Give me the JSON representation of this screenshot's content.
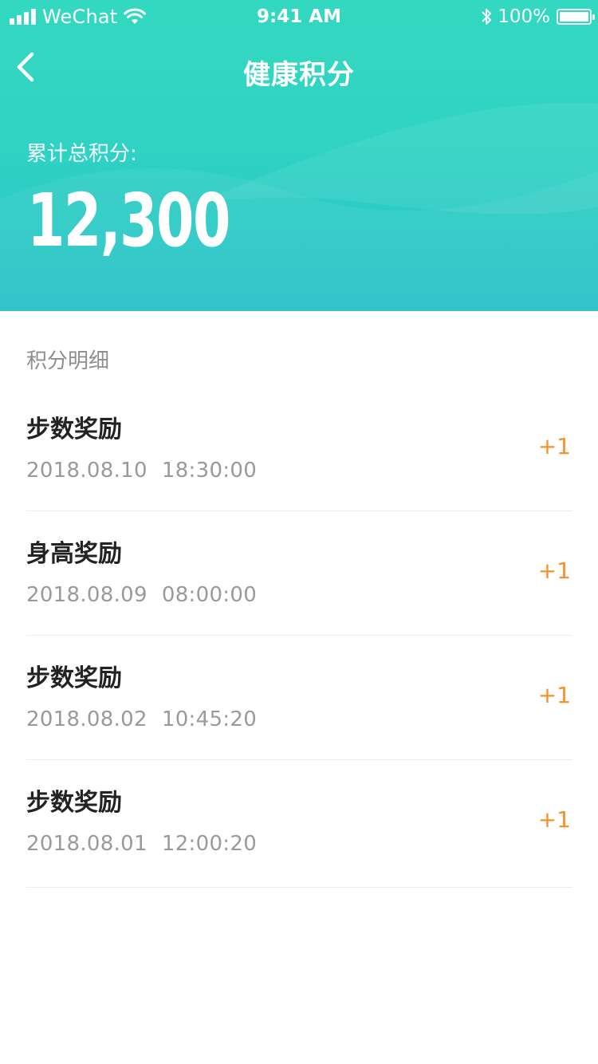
{
  "status_bar": {
    "carrier": "WeChat",
    "time": "9:41 AM",
    "battery": "100%"
  },
  "header": {
    "title": "健康积分",
    "total_label": "累计总积分:",
    "total_value": "12,300"
  },
  "colors": {
    "header_gradient_top": "#33d8c0",
    "header_gradient_bottom": "#27c1c8",
    "points": "#f5912b"
  },
  "details": {
    "section_title": "积分明细",
    "items": [
      {
        "title": "步数奖励",
        "date": "2018.08.10",
        "time": "18:30:00",
        "points": "+1"
      },
      {
        "title": "身高奖励",
        "date": "2018.08.09",
        "time": "08:00:00",
        "points": "+1"
      },
      {
        "title": "步数奖励",
        "date": "2018.08.02",
        "time": "10:45:20",
        "points": "+1"
      },
      {
        "title": "步数奖励",
        "date": "2018.08.01",
        "time": "12:00:20",
        "points": "+1"
      }
    ]
  }
}
